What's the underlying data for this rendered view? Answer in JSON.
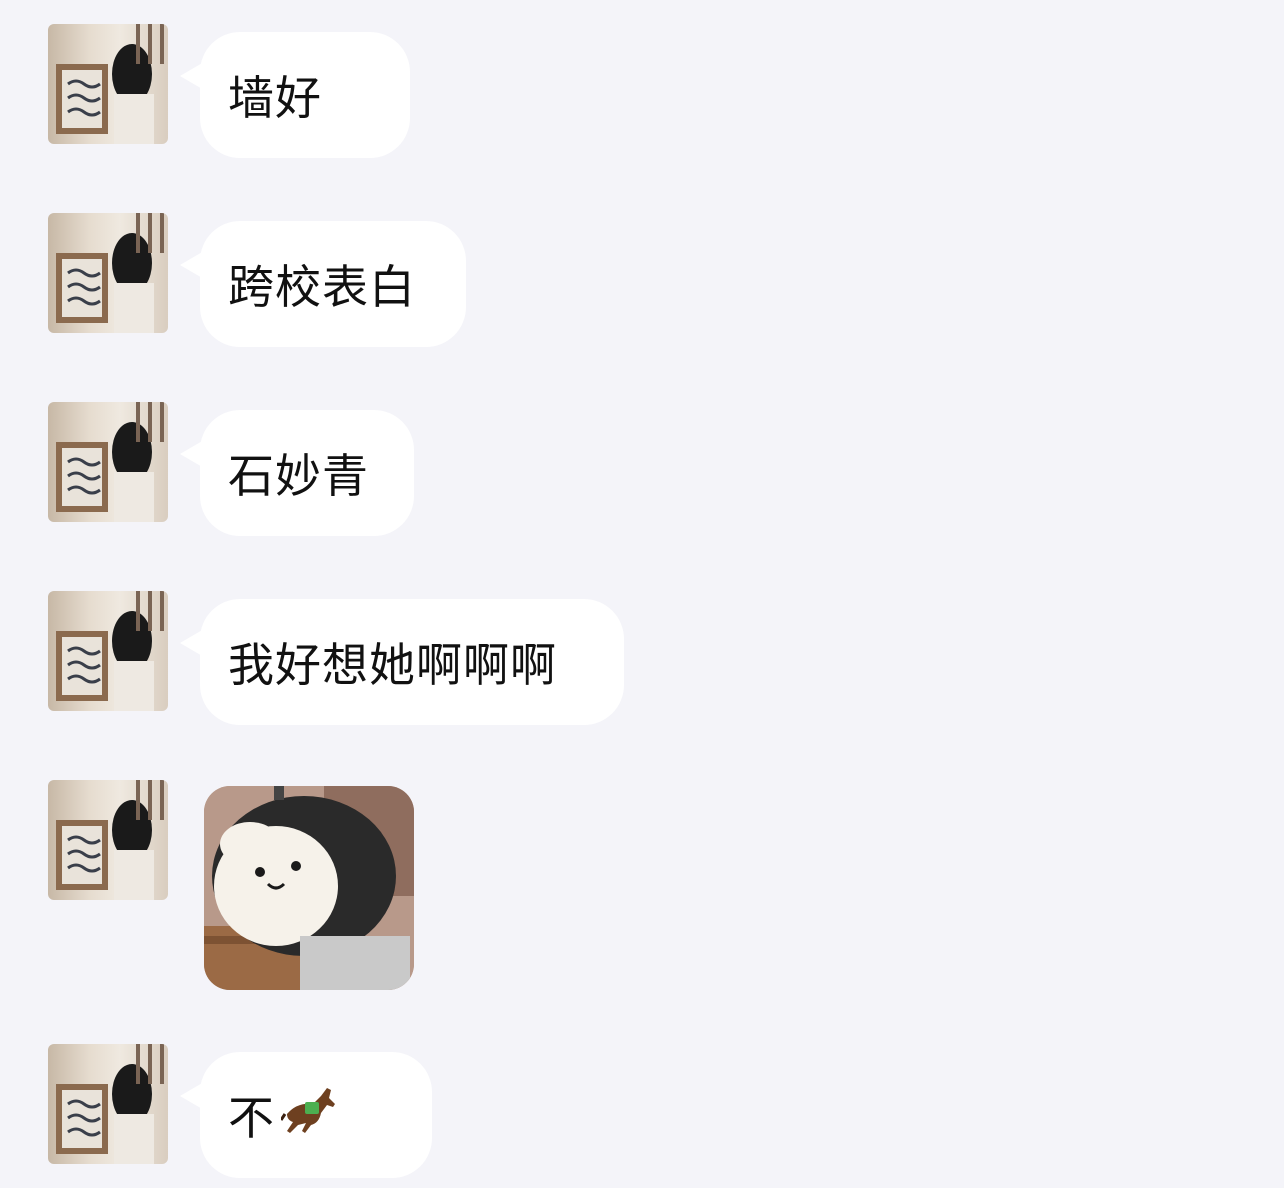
{
  "messages": [
    {
      "type": "text",
      "text": "墙好"
    },
    {
      "type": "text",
      "text": "跨校表白"
    },
    {
      "type": "text",
      "text": "石妙青"
    },
    {
      "type": "text",
      "text": "我好想她啊啊啊"
    },
    {
      "type": "sticker",
      "icon": "penguin-sticker-icon"
    },
    {
      "type": "text",
      "text": "不",
      "emoji": "horse-icon"
    }
  ],
  "colors": {
    "background": "#f4f4f9",
    "bubble": "#ffffff",
    "text": "#111111"
  }
}
